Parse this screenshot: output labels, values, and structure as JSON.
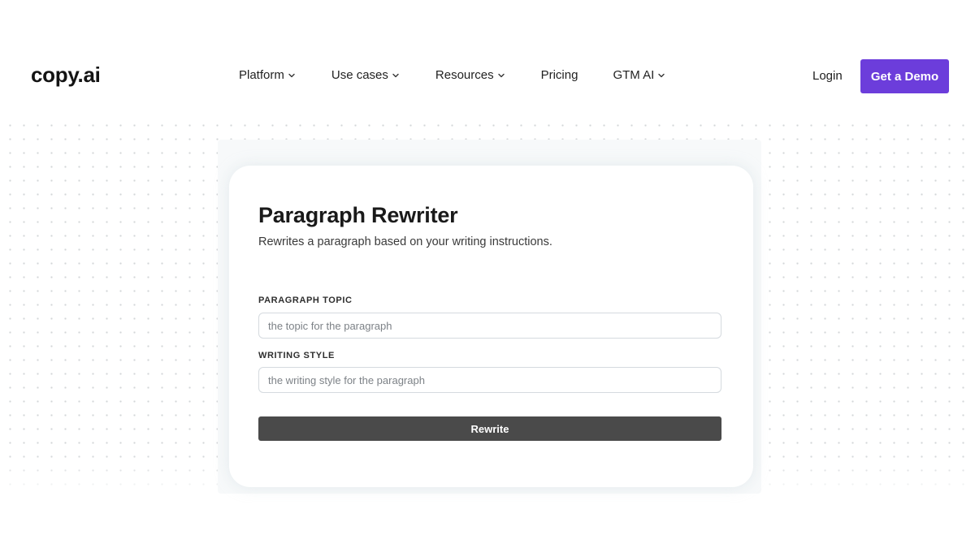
{
  "brand": {
    "logo": "copy.ai",
    "accent": "#6c3ddb"
  },
  "nav": {
    "items": [
      {
        "label": "Platform",
        "dropdown": true,
        "icon": "chevron-down-icon"
      },
      {
        "label": "Use cases",
        "dropdown": true,
        "icon": "chevron-down-icon"
      },
      {
        "label": "Resources",
        "dropdown": true,
        "icon": "chevron-down-icon"
      },
      {
        "label": "Pricing",
        "dropdown": false
      },
      {
        "label": "GTM AI",
        "dropdown": true,
        "icon": "chevron-down-icon"
      }
    ],
    "login_label": "Login",
    "demo_label": "Get a Demo"
  },
  "tool": {
    "title": "Paragraph Rewriter",
    "description": "Rewrites a paragraph based on your writing instructions.",
    "fields": [
      {
        "label": "PARAGRAPH TOPIC",
        "placeholder": "the topic for the paragraph",
        "value": ""
      },
      {
        "label": "WRITING STYLE",
        "placeholder": "the writing style for the paragraph",
        "value": ""
      }
    ],
    "submit_label": "Rewrite",
    "submit_color": "#4a4a4a"
  }
}
